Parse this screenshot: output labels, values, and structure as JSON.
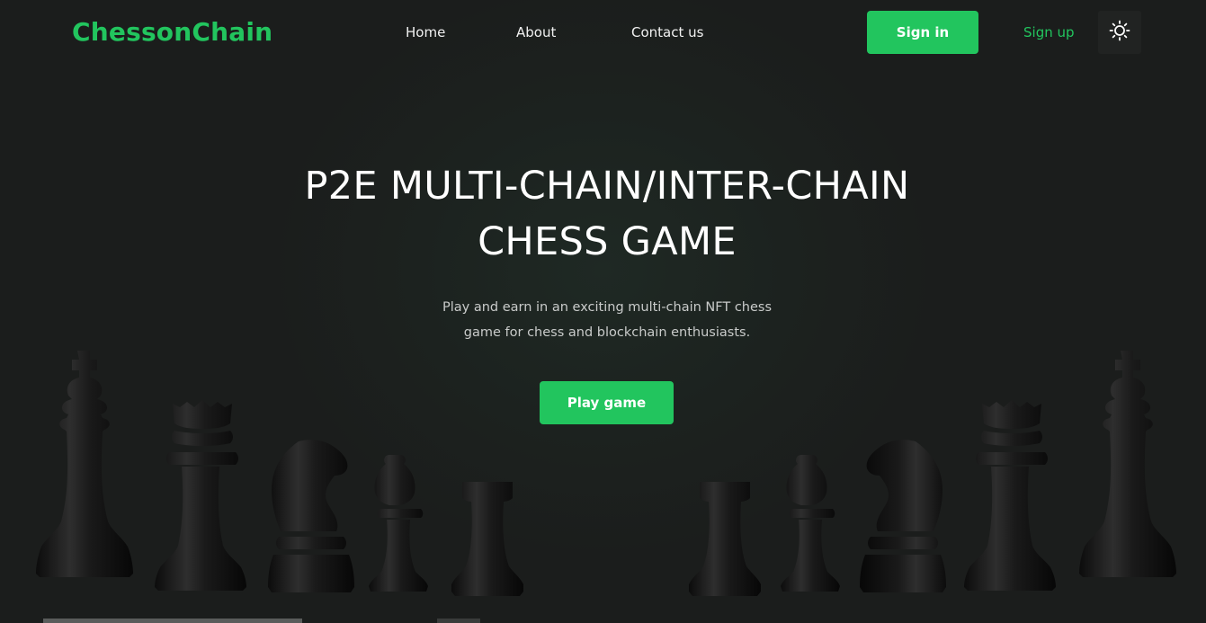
{
  "nav": {
    "logo": "ChessonChain",
    "links": [
      "Home",
      "About",
      "Contact us"
    ],
    "sign_in": "Sign in",
    "sign_up": "Sign up",
    "theme_icon": "sun-icon"
  },
  "hero": {
    "title_line1": "P2E MULTI-CHAIN/INTER-CHAIN",
    "title_line2": "CHESS GAME",
    "subtitle_line1": "Play and earn in an exciting multi-chain NFT chess",
    "subtitle_line2": "game for chess and blockchain enthusiasts.",
    "cta": "Play game"
  },
  "decor": {
    "left_pieces": [
      "king-piece",
      "queen-piece",
      "knight-piece",
      "bishop-piece",
      "rook-piece"
    ],
    "right_pieces": [
      "rook-piece",
      "bishop-piece",
      "knight-piece",
      "queen-piece",
      "king-piece"
    ]
  },
  "colors": {
    "accent": "#22c55e",
    "background": "#1b1d1c",
    "text": "#ffffff"
  }
}
